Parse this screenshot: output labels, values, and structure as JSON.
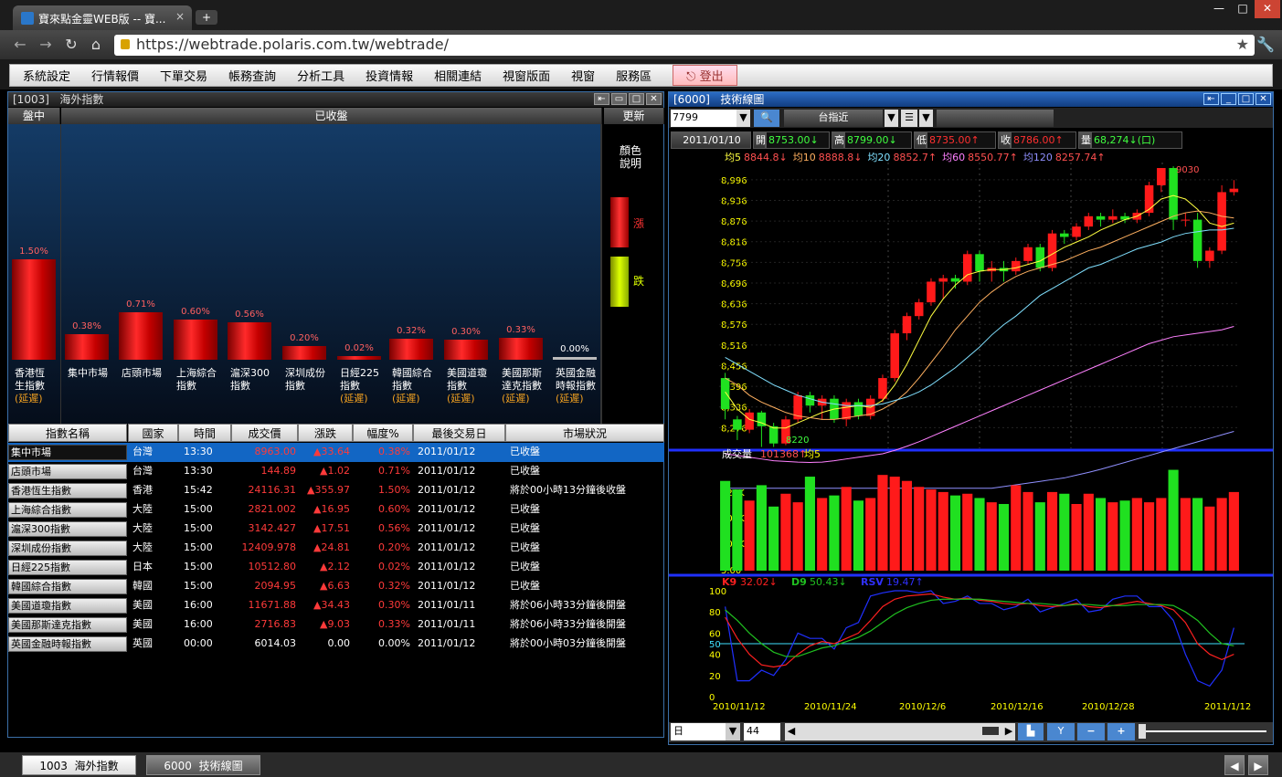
{
  "browser": {
    "tab_title": "寶來點金靈WEB版 -- 寶...",
    "tab_close": "×",
    "newtab": "+",
    "url": "https://webtrade.polaris.com.tw/webtrade/",
    "win_min": "—",
    "win_max": "□",
    "win_close": "✕",
    "back": "←",
    "forward": "→",
    "reload": "↻",
    "star": "★",
    "wrench": "🔧"
  },
  "menu": {
    "items": [
      "系統設定",
      "行情報價",
      "下單交易",
      "帳務查詢",
      "分析工具",
      "投資情報",
      "相關連結",
      "視窗版面",
      "視窗",
      "服務區"
    ],
    "logout": "登出"
  },
  "left_panel": {
    "title_code": "[1003]",
    "title": "海外指數",
    "hdr_session": "盤中",
    "hdr_status": "已收盤",
    "hdr_refresh": "更新",
    "legend_title_1": "顏色",
    "legend_title_2": "說明",
    "legend_up": "漲",
    "legend_down": "跌"
  },
  "bars": [
    {
      "label": [
        "香港恆",
        "生指數"
      ],
      "delay": "(延遲)",
      "pct": "1.50%",
      "value": 1.5
    },
    {
      "label": [
        "集中市場"
      ],
      "delay": "",
      "pct": "0.38%",
      "value": 0.38
    },
    {
      "label": [
        "店頭市場"
      ],
      "delay": "",
      "pct": "0.71%",
      "value": 0.71
    },
    {
      "label": [
        "上海綜合",
        "指數"
      ],
      "delay": "",
      "pct": "0.60%",
      "value": 0.6
    },
    {
      "label": [
        "滬深300",
        "指數"
      ],
      "delay": "",
      "pct": "0.56%",
      "value": 0.56
    },
    {
      "label": [
        "深圳成份",
        "指數"
      ],
      "delay": "",
      "pct": "0.20%",
      "value": 0.2
    },
    {
      "label": [
        "日經225",
        "指數"
      ],
      "delay": "(延遲)",
      "pct": "0.02%",
      "value": 0.02
    },
    {
      "label": [
        "韓國綜合",
        "指數"
      ],
      "delay": "(延遲)",
      "pct": "0.32%",
      "value": 0.32
    },
    {
      "label": [
        "美國道瓊",
        "指數"
      ],
      "delay": "(延遲)",
      "pct": "0.30%",
      "value": 0.3
    },
    {
      "label": [
        "美國那斯",
        "達克指數"
      ],
      "delay": "(延遲)",
      "pct": "0.33%",
      "value": 0.33
    },
    {
      "label": [
        "英國金融",
        "時報指數"
      ],
      "delay": "(延遲)",
      "pct": "0.00%",
      "value": 0.0
    }
  ],
  "table": {
    "headers": [
      "指數名稱",
      "國家",
      "時間",
      "成交價",
      "漲跌",
      "幅度%",
      "最後交易日",
      "市場狀況"
    ],
    "rows": [
      [
        "集中市場",
        "台灣",
        "13:30",
        "8963.00",
        "▲33.64",
        "0.38%",
        "2011/01/12",
        "已收盤"
      ],
      [
        "店頭市場",
        "台灣",
        "13:30",
        "144.89",
        "▲1.02",
        "0.71%",
        "2011/01/12",
        "已收盤"
      ],
      [
        "香港恆生指數",
        "香港",
        "15:42",
        "24116.31",
        "▲355.97",
        "1.50%",
        "2011/01/12",
        "將於00小時13分鐘後收盤"
      ],
      [
        "上海綜合指數",
        "大陸",
        "15:00",
        "2821.002",
        "▲16.95",
        "0.60%",
        "2011/01/12",
        "已收盤"
      ],
      [
        "滬深300指數",
        "大陸",
        "15:00",
        "3142.427",
        "▲17.51",
        "0.56%",
        "2011/01/12",
        "已收盤"
      ],
      [
        "深圳成份指數",
        "大陸",
        "15:00",
        "12409.978",
        "▲24.81",
        "0.20%",
        "2011/01/12",
        "已收盤"
      ],
      [
        "日經225指數",
        "日本",
        "15:00",
        "10512.80",
        "▲2.12",
        "0.02%",
        "2011/01/12",
        "已收盤"
      ],
      [
        "韓國綜合指數",
        "韓國",
        "15:00",
        "2094.95",
        "▲6.63",
        "0.32%",
        "2011/01/12",
        "已收盤"
      ],
      [
        "美國道瓊指數",
        "美國",
        "16:00",
        "11671.88",
        "▲34.43",
        "0.30%",
        "2011/01/11",
        "將於06小時33分鐘後開盤"
      ],
      [
        "美國那斯達克指數",
        "美國",
        "16:00",
        "2716.83",
        "▲9.03",
        "0.33%",
        "2011/01/11",
        "將於06小時33分鐘後開盤"
      ],
      [
        "英國金融時報指數",
        "英國",
        "00:00",
        "6014.03",
        "0.00",
        "0.00%",
        "2011/01/12",
        "將於00小時03分鐘後開盤"
      ]
    ]
  },
  "right_panel": {
    "title_code": "[6000]",
    "title": "技術線圖",
    "symbol": "7799",
    "symbol_name": "台指近",
    "date": "2011/01/10",
    "open_l": "開",
    "open": "8753.00↓",
    "high_l": "高",
    "high": "8799.00↓",
    "low_l": "低",
    "low": "8735.00↑",
    "close_l": "收",
    "close": "8786.00↑",
    "vol_l": "量",
    "vol": "68,274↓(口)",
    "ma": [
      {
        "t": "均5",
        "v": "8844.8↓",
        "c": "#ffff40"
      },
      {
        "t": "均10",
        "v": "8888.8↓",
        "c": "#ffb060"
      },
      {
        "t": "均20",
        "v": "8852.7↑",
        "c": "#80e0ff"
      },
      {
        "t": "均60",
        "v": "8550.77↑",
        "c": "#ff80ff"
      },
      {
        "t": "均120",
        "v": "8257.74↑",
        "c": "#9090ff"
      }
    ],
    "price_high": "9030",
    "price_low": "8220",
    "vol_label": "成交量",
    "vol_value": "101368↑",
    "vol_ma": "均5",
    "kd": [
      {
        "t": "K9",
        "v": "32.02↓",
        "c": "#ff2020"
      },
      {
        "t": "D9",
        "v": "50.43↓",
        "c": "#20c020"
      },
      {
        "t": "RSV",
        "v": "19.47↑",
        "c": "#3030ff"
      }
    ],
    "period": "日",
    "count": "44"
  },
  "chart_data": {
    "type": "candlestick",
    "y_ticks": [
      8276,
      8336,
      8396,
      8456,
      8516,
      8576,
      8636,
      8696,
      8756,
      8816,
      8876,
      8936,
      8996
    ],
    "x_dates": [
      "2010/11/12",
      "2010/11/24",
      "2010/12/6",
      "2010/12/16",
      "2010/12/28",
      "2011/1/12"
    ],
    "vol_ticks": [
      "120K",
      "800K",
      "400K",
      "5.00"
    ],
    "kd_ticks": [
      100,
      80,
      60,
      50,
      40,
      20,
      0
    ],
    "candles": [
      [
        8420,
        8330,
        8435,
        8300
      ],
      [
        8300,
        8270,
        8310,
        8240
      ],
      [
        8270,
        8320,
        8330,
        8260
      ],
      [
        8320,
        8280,
        8325,
        8220
      ],
      [
        8280,
        8230,
        8290,
        8220
      ],
      [
        8230,
        8300,
        8310,
        8225
      ],
      [
        8300,
        8370,
        8380,
        8290
      ],
      [
        8370,
        8340,
        8380,
        8320
      ],
      [
        8340,
        8360,
        8370,
        8300
      ],
      [
        8360,
        8300,
        8370,
        8290
      ],
      [
        8300,
        8350,
        8360,
        8280
      ],
      [
        8350,
        8310,
        8360,
        8300
      ],
      [
        8310,
        8360,
        8370,
        8300
      ],
      [
        8360,
        8420,
        8430,
        8350
      ],
      [
        8420,
        8550,
        8560,
        8410
      ],
      [
        8550,
        8600,
        8610,
        8530
      ],
      [
        8600,
        8640,
        8650,
        8590
      ],
      [
        8640,
        8700,
        8710,
        8630
      ],
      [
        8700,
        8710,
        8720,
        8650
      ],
      [
        8710,
        8700,
        8720,
        8680
      ],
      [
        8700,
        8780,
        8790,
        8690
      ],
      [
        8780,
        8730,
        8790,
        8700
      ],
      [
        8730,
        8740,
        8760,
        8700
      ],
      [
        8740,
        8730,
        8760,
        8700
      ],
      [
        8730,
        8760,
        8770,
        8720
      ],
      [
        8760,
        8800,
        8810,
        8750
      ],
      [
        8800,
        8740,
        8810,
        8730
      ],
      [
        8740,
        8840,
        8850,
        8730
      ],
      [
        8840,
        8830,
        8850,
        8810
      ],
      [
        8830,
        8860,
        8870,
        8820
      ],
      [
        8860,
        8890,
        8900,
        8850
      ],
      [
        8890,
        8880,
        8900,
        8860
      ],
      [
        8880,
        8890,
        8910,
        8870
      ],
      [
        8890,
        8880,
        8900,
        8870
      ],
      [
        8880,
        8900,
        8910,
        8870
      ],
      [
        8900,
        8980,
        8990,
        8890
      ],
      [
        8980,
        9030,
        9030,
        8960
      ],
      [
        9030,
        8880,
        9035,
        8850
      ],
      [
        8880,
        8880,
        8900,
        8860
      ],
      [
        8880,
        8760,
        8900,
        8740
      ],
      [
        8760,
        8790,
        8800,
        8740
      ],
      [
        8790,
        8960,
        8980,
        8780
      ],
      [
        8960,
        8970,
        8995,
        8950
      ]
    ],
    "volumes": [
      105,
      95,
      82,
      100,
      75,
      90,
      80,
      110,
      85,
      88,
      98,
      82,
      85,
      112,
      110,
      105,
      98,
      95,
      92,
      88,
      90,
      85,
      80,
      78,
      100,
      92,
      80,
      92,
      90,
      78,
      90,
      85,
      80,
      82,
      85,
      80,
      85,
      118,
      85,
      85,
      75,
      85,
      92,
      70
    ],
    "ma5": [
      8380,
      8330,
      8300,
      8290,
      8275,
      8275,
      8290,
      8305,
      8320,
      8330,
      8335,
      8340,
      8335,
      8355,
      8400,
      8460,
      8530,
      8600,
      8650,
      8690,
      8720,
      8730,
      8735,
      8735,
      8740,
      8750,
      8760,
      8780,
      8800,
      8815,
      8830,
      8850,
      8865,
      8880,
      8890,
      8910,
      8940,
      8950,
      8940,
      8910,
      8870,
      8860,
      8870
    ],
    "ma10": [
      8420,
      8400,
      8370,
      8350,
      8335,
      8320,
      8310,
      8305,
      8300,
      8300,
      8305,
      8310,
      8315,
      8330,
      8350,
      8380,
      8420,
      8465,
      8510,
      8560,
      8600,
      8640,
      8670,
      8695,
      8715,
      8730,
      8740,
      8750,
      8760,
      8775,
      8790,
      8800,
      8815,
      8830,
      8845,
      8860,
      8875,
      8890,
      8900,
      8905,
      8900,
      8890,
      8885
    ],
    "ma20": [
      8480,
      8460,
      8440,
      8420,
      8400,
      8385,
      8370,
      8360,
      8350,
      8345,
      8340,
      8340,
      8340,
      8345,
      8355,
      8365,
      8380,
      8400,
      8425,
      8450,
      8480,
      8510,
      8545,
      8575,
      8600,
      8630,
      8660,
      8680,
      8700,
      8720,
      8740,
      8750,
      8765,
      8780,
      8795,
      8805,
      8815,
      8830,
      8840,
      8845,
      8850,
      8850,
      8855
    ],
    "ma60": [
      8200,
      8195,
      8190,
      8185,
      8180,
      8178,
      8176,
      8175,
      8176,
      8180,
      8185,
      8190,
      8195,
      8200,
      8210,
      8222,
      8235,
      8250,
      8265,
      8280,
      8295,
      8310,
      8325,
      8340,
      8355,
      8370,
      8385,
      8400,
      8415,
      8430,
      8445,
      8460,
      8475,
      8490,
      8505,
      8520,
      8530,
      8540,
      8545,
      8550,
      8555,
      8560,
      8570
    ],
    "ma120": [
      8100,
      8100,
      8100,
      8100,
      8100,
      8100,
      8100,
      8100,
      8100,
      8100,
      8100,
      8100,
      8100,
      8100,
      8100,
      8100,
      8100,
      8100,
      8100,
      8100,
      8100,
      8100,
      8100,
      8105,
      8110,
      8115,
      8120,
      8125,
      8130,
      8138,
      8146,
      8155,
      8165,
      8175,
      8185,
      8195,
      8205,
      8215,
      8225,
      8235,
      8245,
      8255,
      8265
    ],
    "k": [
      75,
      55,
      40,
      30,
      28,
      30,
      40,
      48,
      52,
      50,
      55,
      60,
      72,
      85,
      92,
      95,
      96,
      97,
      94,
      92,
      93,
      91,
      90,
      88,
      87,
      88,
      86,
      85,
      86,
      88,
      85,
      84,
      86,
      88,
      90,
      88,
      86,
      82,
      70,
      50,
      40,
      35,
      40
    ],
    "d": [
      82,
      72,
      60,
      50,
      42,
      38,
      38,
      42,
      46,
      48,
      52,
      56,
      62,
      70,
      78,
      84,
      88,
      91,
      92,
      92,
      92,
      92,
      91,
      90,
      89,
      88,
      88,
      87,
      86,
      87,
      87,
      86,
      86,
      86,
      87,
      87,
      87,
      86,
      80,
      72,
      60,
      50,
      48
    ],
    "rsv": [
      85,
      15,
      15,
      25,
      20,
      35,
      60,
      55,
      55,
      45,
      65,
      70,
      95,
      98,
      100,
      100,
      98,
      100,
      88,
      90,
      95,
      88,
      88,
      82,
      85,
      92,
      80,
      84,
      88,
      92,
      80,
      82,
      92,
      95,
      95,
      85,
      85,
      72,
      40,
      15,
      10,
      25,
      65
    ]
  }
}
